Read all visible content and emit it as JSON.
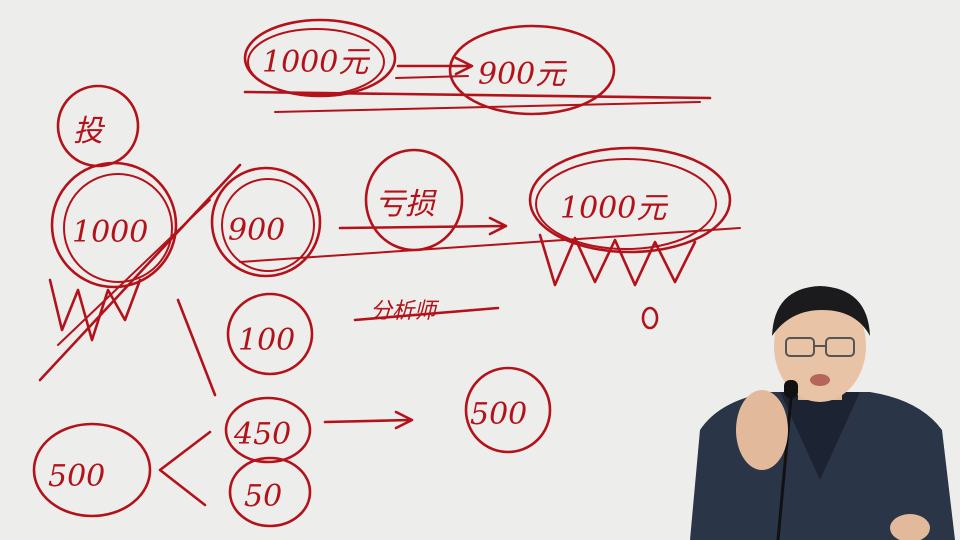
{
  "whiteboard": {
    "ink_color": "#b3121a",
    "background_color": "#ededeb",
    "labels": {
      "top_left": "1000元",
      "top_right": "900元",
      "side_char": "投",
      "left_amount": "1000",
      "mid_amount": "900",
      "middle_char": "亏损",
      "right_amount": "1000元",
      "lower_mid_amount": "100",
      "bottom_left_amount": "500",
      "bottom_upper_amount": "450",
      "bottom_lower_amount": "50",
      "bottom_right_amount": "500",
      "struck_text": "分析师"
    }
  },
  "presenter": {
    "shirt_color": "#1c2433",
    "jacket_color": "#2a3547",
    "skin_color": "#e9c3a6",
    "hair_color": "#1b1b1d"
  }
}
